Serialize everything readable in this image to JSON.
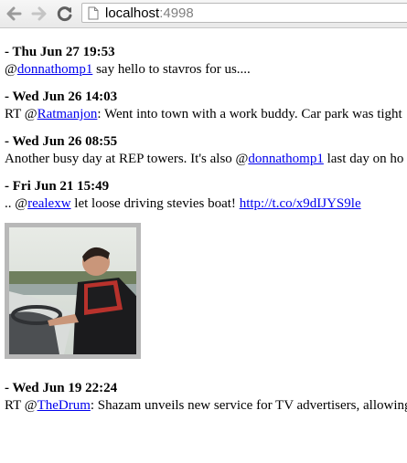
{
  "browser": {
    "url_host": "localhost",
    "url_port": ":4998"
  },
  "tweets": [
    {
      "date": "- Thu Jun 27 19:53",
      "pre": "@",
      "link": "donnathomp1",
      "post": " say hello to stavros for us...."
    },
    {
      "date": "- Wed Jun 26 14:03",
      "pre": "RT @",
      "link": "Ratmanjon",
      "post": ": Went into town with a work buddy. Car park was tight"
    },
    {
      "date": "- Wed Jun 26 08:55",
      "pre": "Another busy day at REP towers. It's also @",
      "link": "donnathomp1",
      "post": " last day on ho"
    },
    {
      "date": "- Fri Jun 21 15:49",
      "pre": ".. @",
      "link": "realexw",
      "mid": " let loose driving stevies boat! ",
      "link2": "http://t.co/x9dIJYS9le"
    },
    {
      "date": "- Wed Jun 19 22:24",
      "pre": "RT @",
      "link": "TheDrum",
      "post": ": Shazam unveils new service for TV advertisers, allowing"
    }
  ],
  "icons": {
    "back": "arrow-left",
    "forward": "arrow-right",
    "reload": "reload",
    "page": "document"
  }
}
